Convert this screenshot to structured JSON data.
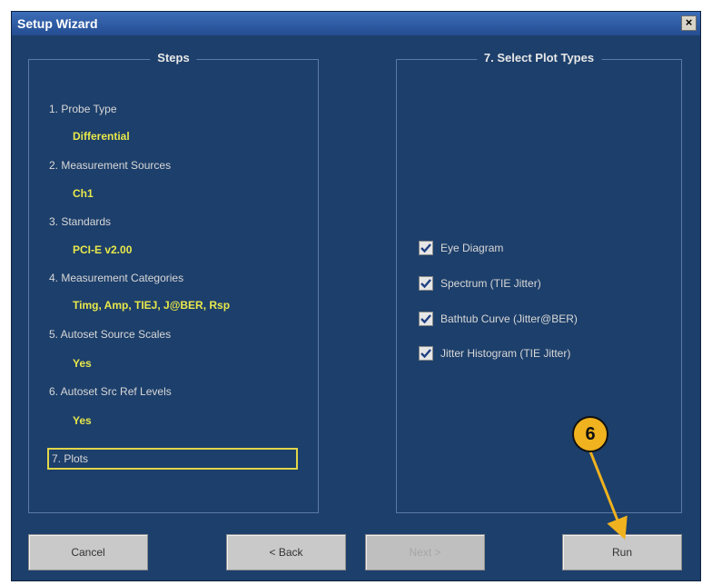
{
  "window": {
    "title": "Setup Wizard",
    "close_label": "×"
  },
  "steps_panel": {
    "title": "Steps",
    "steps": [
      {
        "label": "1. Probe Type",
        "value": "Differential"
      },
      {
        "label": "2. Measurement Sources",
        "value": "Ch1"
      },
      {
        "label": "3. Standards",
        "value": "PCI-E v2.00"
      },
      {
        "label": "4. Measurement Categories",
        "value": "Timg, Amp, TIEJ, J@BER, Rsp"
      },
      {
        "label": "5. Autoset Source Scales",
        "value": "Yes"
      },
      {
        "label": "6. Autoset Src Ref Levels",
        "value": "Yes"
      }
    ],
    "current_step": "7. Plots"
  },
  "plot_panel": {
    "title": "7. Select Plot Types",
    "options": [
      {
        "label": "Eye Diagram",
        "checked": true
      },
      {
        "label": "Spectrum (TIE Jitter)",
        "checked": true
      },
      {
        "label": "Bathtub Curve (Jitter@BER)",
        "checked": true
      },
      {
        "label": "Jitter Histogram (TIE Jitter)",
        "checked": true
      }
    ]
  },
  "buttons": {
    "cancel": "Cancel",
    "back": "< Back",
    "next": "Next >",
    "run": "Run"
  },
  "callout": {
    "number": "6"
  }
}
